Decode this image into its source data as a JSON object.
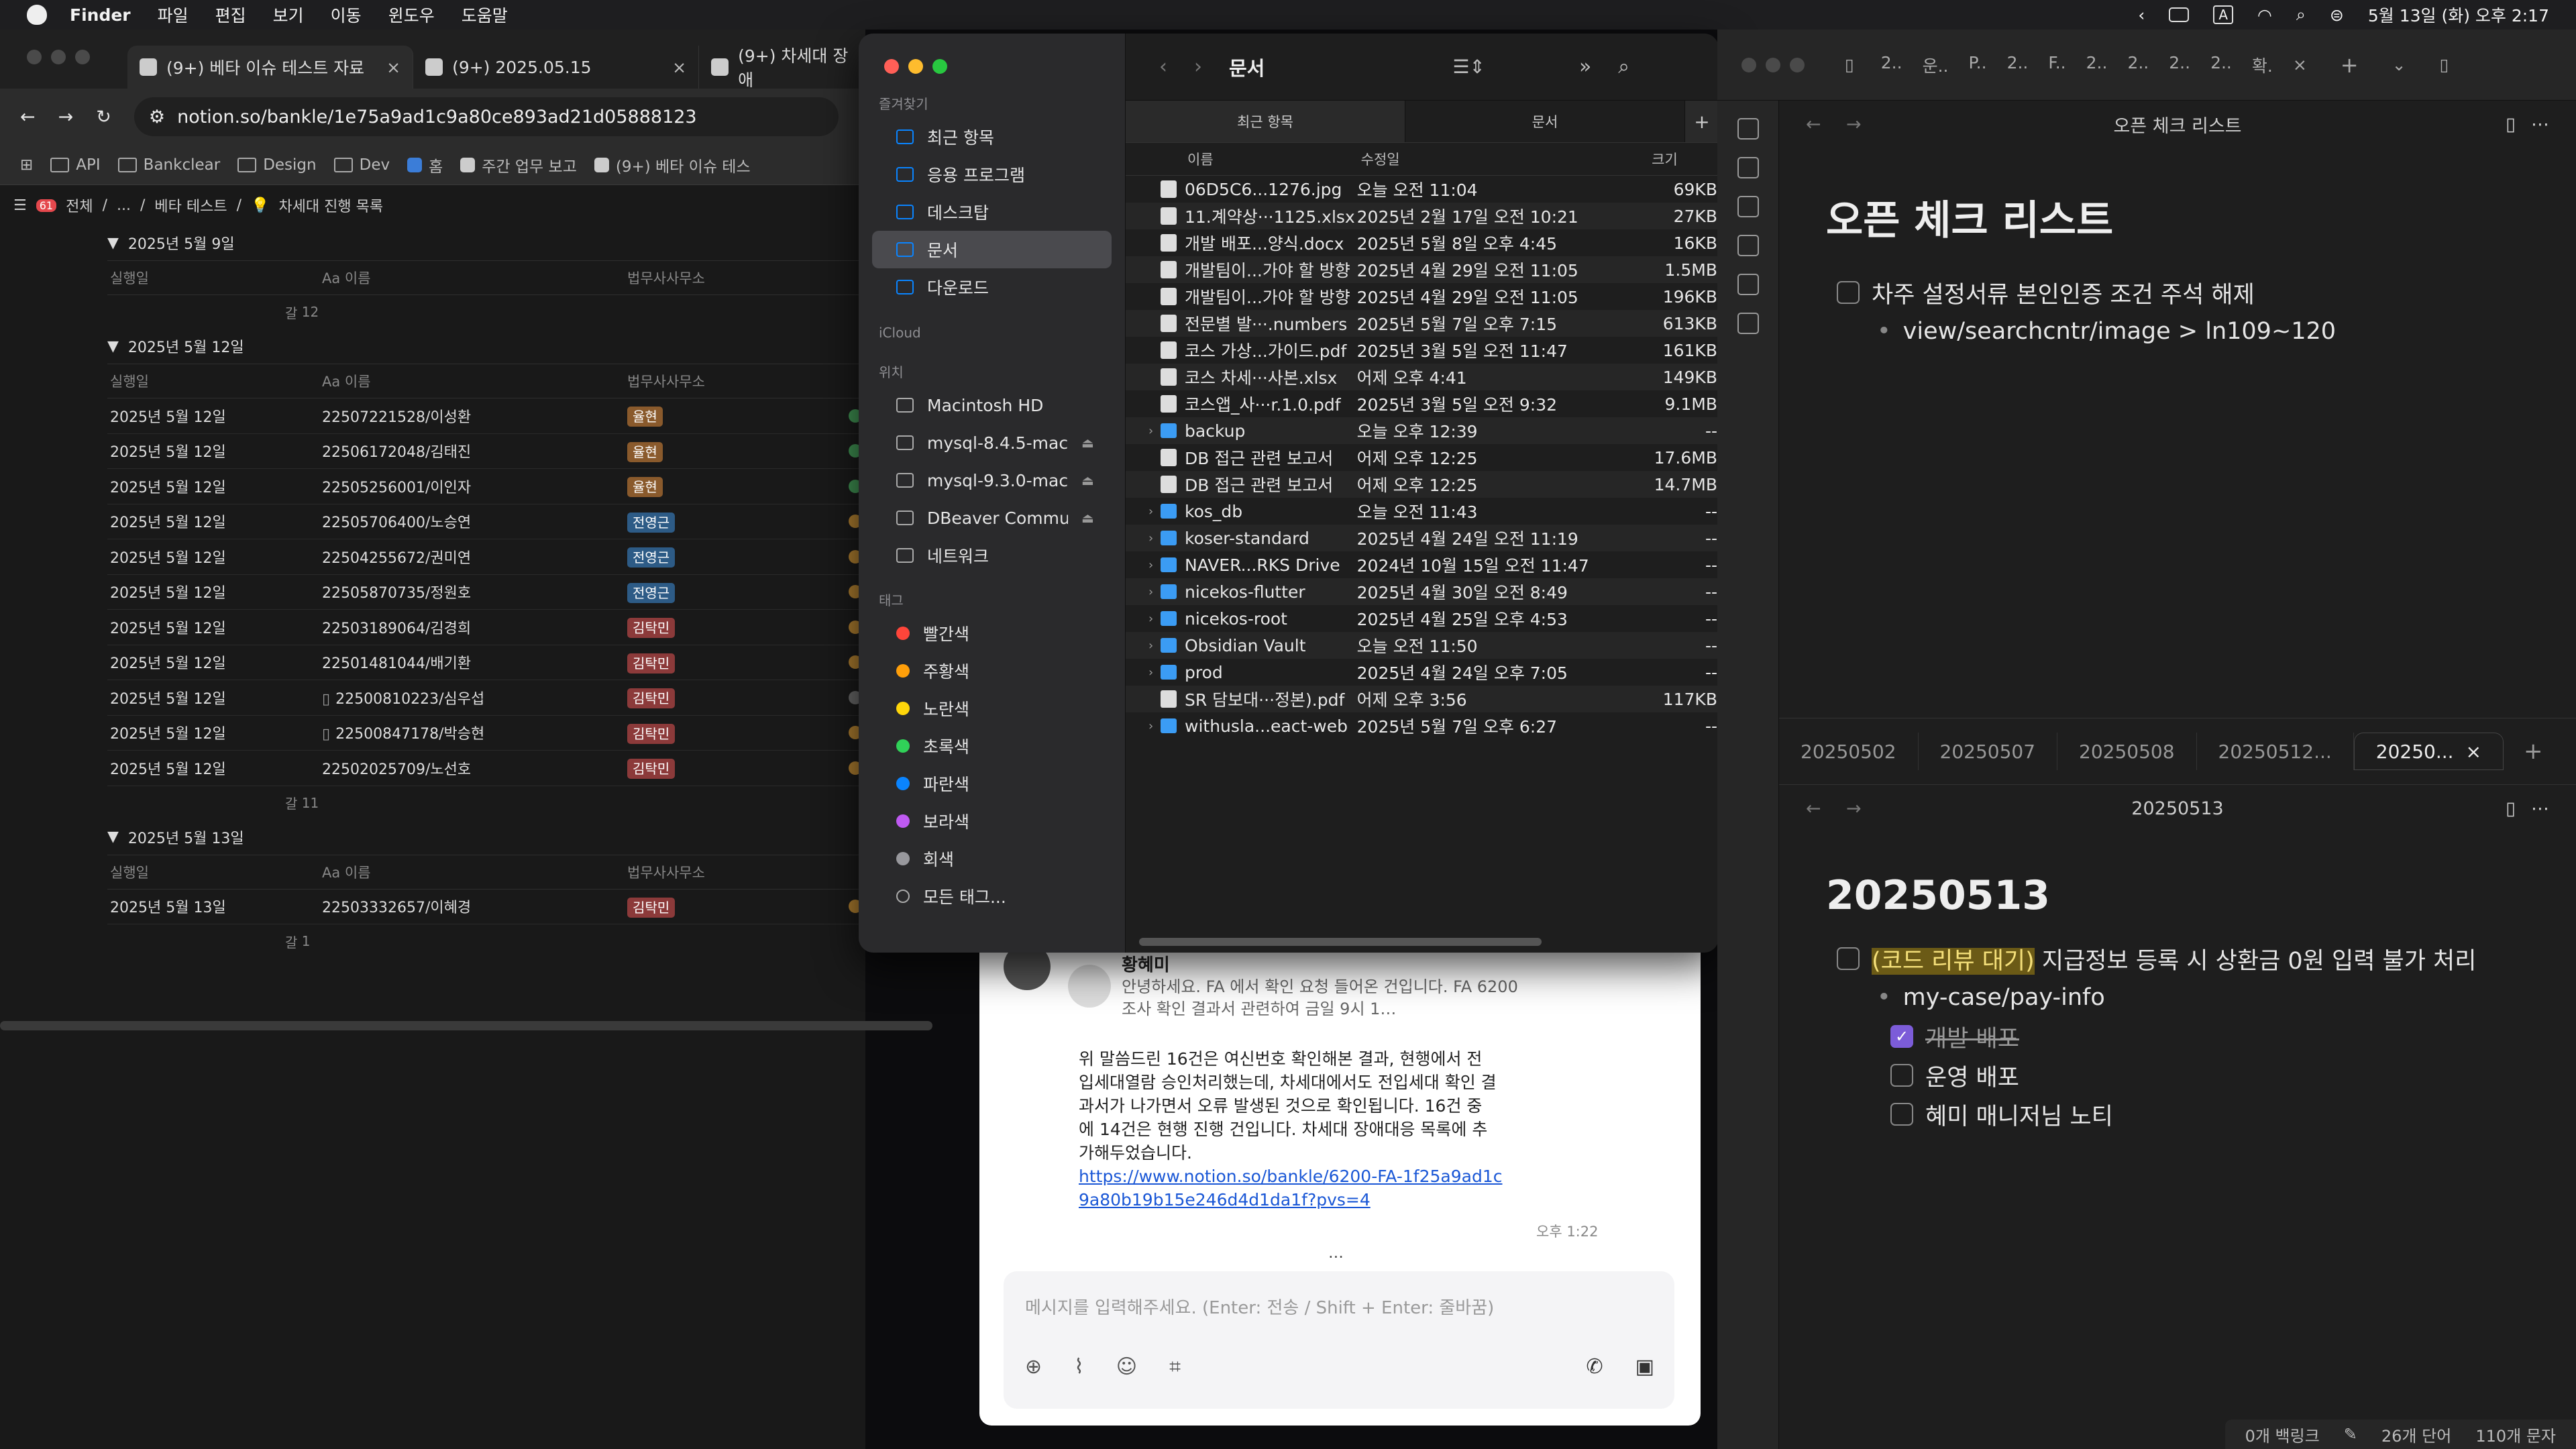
{
  "menubar": {
    "app": "Finder",
    "items": [
      "파일",
      "편집",
      "보기",
      "이동",
      "윈도우",
      "도움말"
    ],
    "clock": "5월 13일 (화) 오후 2:17",
    "input_badge": "A"
  },
  "browser": {
    "tabs": [
      {
        "title": "(9+) 베타 이슈 테스트 자료"
      },
      {
        "title": "(9+) 2025.05.15"
      },
      {
        "title": "(9+) 차세대 장애"
      }
    ],
    "url": "notion.so/bankle/1e75a9ad1c9a80ce893ad21d05888123",
    "bookmarks": [
      "API",
      "Bankclear",
      "Design",
      "Dev",
      "홈",
      "주간 업무 보고",
      "(9+) 베타 이슈 테스"
    ],
    "breadcrumb": [
      "전체",
      "...",
      "베타 테스트",
      "차세대 진행 목록"
    ],
    "notif_badge": "61",
    "columns": {
      "date": "실행일",
      "name": "Aa 이름",
      "law": "법무사사무소"
    },
    "groups": [
      {
        "title": "2025년 5월 9일",
        "count": "12",
        "rows": []
      },
      {
        "title": "2025년 5월 12일",
        "count": "11",
        "rows": [
          {
            "date": "2025년 5월 12일",
            "name": "22507221528/이성환",
            "tag": "율현",
            "tagcolor": "#8a5a2c",
            "dot": "#3d8c4f",
            "doc": false
          },
          {
            "date": "2025년 5월 12일",
            "name": "22506172048/김태진",
            "tag": "율현",
            "tagcolor": "#8a5a2c",
            "dot": "#3d8c4f",
            "doc": false
          },
          {
            "date": "2025년 5월 12일",
            "name": "22505256001/이인자",
            "tag": "율현",
            "tagcolor": "#8a5a2c",
            "dot": "#3d8c4f",
            "doc": false
          },
          {
            "date": "2025년 5월 12일",
            "name": "22505706400/노승연",
            "tag": "전영근",
            "tagcolor": "#2d5b86",
            "dot": "#a97a2e",
            "doc": false
          },
          {
            "date": "2025년 5월 12일",
            "name": "22504255672/권미연",
            "tag": "전영근",
            "tagcolor": "#2d5b86",
            "dot": "#a97a2e",
            "doc": false
          },
          {
            "date": "2025년 5월 12일",
            "name": "22505870735/정원호",
            "tag": "전영근",
            "tagcolor": "#2d5b86",
            "dot": "#a97a2e",
            "doc": false
          },
          {
            "date": "2025년 5월 12일",
            "name": "22503189064/김경희",
            "tag": "김탁민",
            "tagcolor": "#8c3a3a",
            "dot": "#a97a2e",
            "doc": false
          },
          {
            "date": "2025년 5월 12일",
            "name": "22501481044/배기환",
            "tag": "김탁민",
            "tagcolor": "#8c3a3a",
            "dot": "#a97a2e",
            "doc": false
          },
          {
            "date": "2025년 5월 12일",
            "name": "22500810223/심우섭",
            "tag": "김탁민",
            "tagcolor": "#8c3a3a",
            "dot": "#666",
            "doc": true
          },
          {
            "date": "2025년 5월 12일",
            "name": "22500847178/박승현",
            "tag": "김탁민",
            "tagcolor": "#8c3a3a",
            "dot": "#a97a2e",
            "doc": true
          },
          {
            "date": "2025년 5월 12일",
            "name": "22502025709/노선호",
            "tag": "김탁민",
            "tagcolor": "#8c3a3a",
            "dot": "#a97a2e",
            "doc": false
          }
        ]
      },
      {
        "title": "2025년 5월 13일",
        "count": "1",
        "rows": [
          {
            "date": "2025년 5월 13일",
            "name": "22503332657/이혜경",
            "tag": "김탁민",
            "tagcolor": "#8c3a3a",
            "dot": "#a97a2e",
            "doc": false
          }
        ]
      }
    ],
    "count_prefix": "갈"
  },
  "chat": {
    "sender": "황혜미",
    "quote": "안녕하세요. FA 에서 확인 요청 들어온 건입니다. FA 6200 조사 확인 결과서 관련하여 금일 9시 1…",
    "body": "위 말씀드린 16건은 여신번호 확인해본 결과, 현행에서 전입세대열람 승인처리했는데, 차세대에서도 전입세대 확인 결과서가 나가면서 오류 발생된 것으로 확인됩니다. 16건 중에 14건은 현행 진행 건입니다. 차세대 장애대응 목록에 추가해두었습니다.",
    "link": "https://www.notion.so/bankle/6200-FA-1f25a9ad1c9a80b19b15e246d4d1da1f?pvs=4",
    "time": "오후 1:22",
    "more": "···",
    "placeholder": "메시지를 입력해주세요. (Enter: 전송 / Shift + Enter: 줄바꿈)"
  },
  "finder": {
    "title": "문서",
    "tabs": [
      "최근 항목",
      "문서"
    ],
    "cols": {
      "name": "이름",
      "date": "수정일",
      "size": "크기"
    },
    "sidebar": {
      "favorites_label": "즐겨찾기",
      "favorites": [
        "최근 항목",
        "응용 프로그램",
        "데스크탑",
        "문서",
        "다운로드"
      ],
      "icloud_label": "iCloud",
      "locations_label": "위치",
      "locations": [
        "Macintosh HD",
        "mysql-8.4.5-mac...",
        "mysql-9.3.0-mac...",
        "DBeaver Commun...",
        "네트워크"
      ],
      "tags_label": "태그",
      "tags": [
        {
          "name": "빨간색",
          "color": "#ff453a"
        },
        {
          "name": "주황색",
          "color": "#ff9f0a"
        },
        {
          "name": "노란색",
          "color": "#ffd60a"
        },
        {
          "name": "초록색",
          "color": "#30d158"
        },
        {
          "name": "파란색",
          "color": "#0a84ff"
        },
        {
          "name": "보라색",
          "color": "#bf5af2"
        },
        {
          "name": "회색",
          "color": "#98989d"
        },
        {
          "name": "모든 태그...",
          "color": ""
        }
      ]
    },
    "files": [
      {
        "name": "06D5C6...1276.jpg",
        "date": "오늘 오전 11:04",
        "size": "69KB",
        "dir": false
      },
      {
        "name": "11.계약상···1125.xlsx",
        "date": "2025년 2월 17일 오전 10:21",
        "size": "27KB",
        "dir": false
      },
      {
        "name": "개발 배포...양식.docx",
        "date": "2025년 5월 8일 오후 4:45",
        "size": "16KB",
        "dir": false
      },
      {
        "name": "개발팀이...가야 할 방향",
        "date": "2025년 4월 29일 오전 11:05",
        "size": "1.5MB",
        "dir": false
      },
      {
        "name": "개발팀이...가야 할 방향",
        "date": "2025년 4월 29일 오전 11:05",
        "size": "196KB",
        "dir": false
      },
      {
        "name": "전문별 발···.numbers",
        "date": "2025년 5월 7일 오후 7:15",
        "size": "613KB",
        "dir": false
      },
      {
        "name": "코스 가상...가이드.pdf",
        "date": "2025년 3월 5일 오전 11:47",
        "size": "161KB",
        "dir": false
      },
      {
        "name": "코스 차세···사본.xlsx",
        "date": "어제 오후 4:41",
        "size": "149KB",
        "dir": false
      },
      {
        "name": "코스앱_사···r.1.0.pdf",
        "date": "2025년 3월 5일 오전 9:32",
        "size": "9.1MB",
        "dir": false
      },
      {
        "name": "backup",
        "date": "오늘 오후 12:39",
        "size": "--",
        "dir": true
      },
      {
        "name": "DB 접근 관련 보고서",
        "date": "어제 오후 12:25",
        "size": "17.6MB",
        "dir": false
      },
      {
        "name": "DB 접근 관련 보고서",
        "date": "어제 오후 12:25",
        "size": "14.7MB",
        "dir": false
      },
      {
        "name": "kos_db",
        "date": "오늘 오전 11:43",
        "size": "--",
        "dir": true
      },
      {
        "name": "koser-standard",
        "date": "2025년 4월 24일 오전 11:19",
        "size": "--",
        "dir": true
      },
      {
        "name": "NAVER...RKS Drive",
        "date": "2024년 10월 15일 오전 11:47",
        "size": "--",
        "dir": true
      },
      {
        "name": "nicekos-flutter",
        "date": "2025년 4월 30일 오전 8:49",
        "size": "--",
        "dir": true
      },
      {
        "name": "nicekos-root",
        "date": "2025년 4월 25일 오후 4:53",
        "size": "--",
        "dir": true
      },
      {
        "name": "Obsidian Vault",
        "date": "오늘 오전 11:50",
        "size": "--",
        "dir": true
      },
      {
        "name": "prod",
        "date": "2025년 4월 24일 오후 7:05",
        "size": "--",
        "dir": true
      },
      {
        "name": "SR 담보대···정본).pdf",
        "date": "어제 오후 3:56",
        "size": "117KB",
        "dir": false
      },
      {
        "name": "withusla...eact-web",
        "date": "2025년 5월 7일 오후 6:27",
        "size": "--",
        "dir": true
      }
    ]
  },
  "obsidian": {
    "top_tabs": [
      "2..",
      "운..",
      "P..",
      "2..",
      "F..",
      "2..",
      "2..",
      "2..",
      "2..",
      "확."
    ],
    "pane1": {
      "nav_title": "오픈 체크 리스트",
      "title": "오픈 체크 리스트",
      "items": [
        "차주 설정서류 본인인증 조건 주석 해제"
      ],
      "sub": "view/searchcntr/image > ln109~120"
    },
    "pane2": {
      "tabs": [
        "20250502",
        "20250507",
        "20250508",
        "20250512...",
        "20250..."
      ],
      "nav_title": "20250513",
      "title": "20250513",
      "highlight": "(코드 리뷰 대기)",
      "task": " 지급정보 등록 시 상환금 0원 입력 불가 처리",
      "sub": "my-case/pay-info",
      "subtasks": [
        {
          "text": "개발 배포",
          "done": true
        },
        {
          "text": "운영 배포",
          "done": false
        },
        {
          "text": "혜미 매니저님 노티",
          "done": false
        }
      ]
    },
    "status": {
      "backlinks": "0개 백링크",
      "words": "26개 단어",
      "chars": "110개 문자"
    }
  },
  "colors": {
    "accent": "#7c5cd8",
    "finder_selected": "#4a4a4e",
    "link": "#1a57d6"
  }
}
